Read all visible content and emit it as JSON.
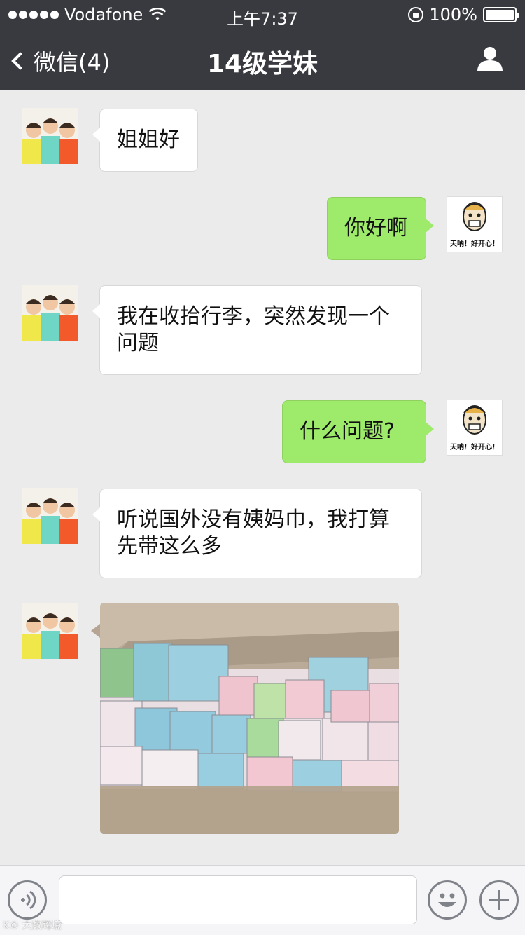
{
  "status_bar": {
    "carrier": "Vodafone",
    "time": "上午7:37",
    "battery_percent": "100%"
  },
  "nav": {
    "back_label": "微信(4)",
    "title": "14级学妹"
  },
  "messages": [
    {
      "side": "left",
      "text": "姐姐好"
    },
    {
      "side": "right",
      "text": "你好啊",
      "sticker_caption": "天呐！好开心！"
    },
    {
      "side": "left",
      "text": "我在收拾行李，突然发现一个问题"
    },
    {
      "side": "right",
      "text": "什么问题?",
      "sticker_caption": "天呐！好开心！"
    },
    {
      "side": "left",
      "text": "听说国外没有姨妈巾，我打算先带这么多"
    },
    {
      "side": "left",
      "type": "image",
      "text": ""
    }
  ],
  "input_bar": {
    "placeholder": ""
  },
  "watermark": "K© 大数跨境",
  "colors": {
    "nav_bg": "#393a3f",
    "chat_bg": "#ebebeb",
    "bubble_self": "#9eea6a",
    "bubble_other": "#ffffff"
  },
  "icons": {
    "back": "chevron-left-icon",
    "profile": "person-icon",
    "voice": "voice-icon",
    "emoji": "smiley-icon",
    "plus": "plus-icon"
  }
}
